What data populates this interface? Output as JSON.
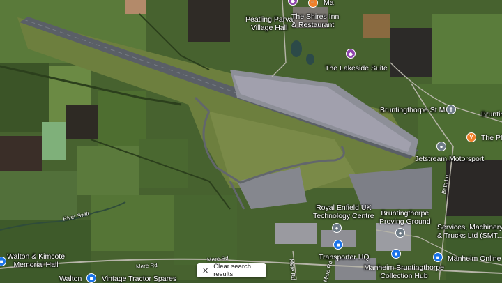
{
  "map": {
    "places": {
      "peatling_parva": "Peatling Parva\nVillage Hall",
      "shires_inn": "The Shires Inn\n& Restaurant",
      "lakeside_suite": "The Lakeside Suite",
      "bruntingthorpe_st_mary": "Bruntingthorpe St Mary",
      "bruntin": "Bruntin",
      "the_plough": "The Plou",
      "jetstream": "Jetstream Motorsport",
      "royal_enfield": "Royal Enfield UK\nTechnology Centre",
      "proving_ground": "Bruntingthorpe\nProving Ground",
      "services_machinery": "Services, Machinery\n& Trucks Ltd (SMT...",
      "transporter_hq": "Transporter HQ",
      "manheim_collection": "Manheim Bruntingthorpe\nCollection Hub",
      "manheim_online": "Manheim Online",
      "walton_kimcote": "Walton & Kimcote\nMemorial Hall",
      "vintage_tractor": "Vintage Tractor Spares",
      "walton": "Walton",
      "top_partial": "Ma"
    },
    "roads": {
      "river_swift": "River Swift",
      "mere_rd_1": "Mere Rd",
      "mere_rd_2": "Mere Rd",
      "mere_rd_3": "Mere Rd",
      "mere_rd_4": "Mere Rd",
      "bath_ln": "Bath Ln"
    },
    "colors": {
      "pin_grey": "#6e7b86",
      "pin_blue": "#1a73e8",
      "pin_orange": "#f0802a",
      "pin_purple": "#8e44ad"
    }
  },
  "controls": {
    "clear_search": "Clear search results",
    "clear_icon": "close-icon"
  }
}
